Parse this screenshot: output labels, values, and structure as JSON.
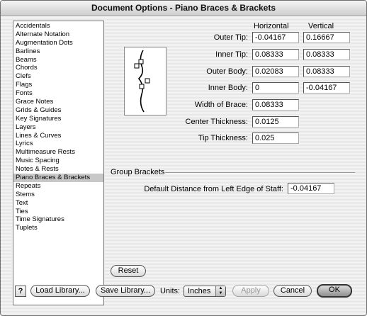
{
  "window": {
    "title": "Document Options - Piano Braces & Brackets"
  },
  "sidebar": {
    "items": [
      "Accidentals",
      "Alternate Notation",
      "Augmentation Dots",
      "Barlines",
      "Beams",
      "Chords",
      "Clefs",
      "Flags",
      "Fonts",
      "Grace Notes",
      "Grids & Guides",
      "Key Signatures",
      "Layers",
      "Lines & Curves",
      "Lyrics",
      "Multimeasure Rests",
      "Music Spacing",
      "Notes & Rests",
      "Piano Braces & Brackets",
      "Repeats",
      "Stems",
      "Text",
      "Ties",
      "Time Signatures",
      "Tuplets"
    ],
    "selected": "Piano Braces & Brackets"
  },
  "columns": {
    "horizontal": "Horizontal",
    "vertical": "Vertical"
  },
  "rows": [
    {
      "label": "Outer Tip:",
      "horizontal": "-0.04167",
      "vertical": "0.16667"
    },
    {
      "label": "Inner Tip:",
      "horizontal": "0.08333",
      "vertical": "0.08333"
    },
    {
      "label": "Outer Body:",
      "horizontal": "0.02083",
      "vertical": "0.08333"
    },
    {
      "label": "Inner Body:",
      "horizontal": "0",
      "vertical": "-0.04167"
    },
    {
      "label": "Width of Brace:",
      "horizontal": "0.08333"
    },
    {
      "label": "Center Thickness:",
      "horizontal": "0.0125"
    },
    {
      "label": "Tip Thickness:",
      "horizontal": "0.025"
    }
  ],
  "group_brackets": {
    "title": "Group Brackets",
    "distance_label": "Default Distance from Left Edge of Staff:",
    "distance_value": "-0.04167"
  },
  "buttons": {
    "reset": "Reset",
    "help": "?",
    "load_library": "Load Library...",
    "save_library": "Save Library...",
    "units_label": "Units:",
    "units_value": "Inches",
    "apply": "Apply",
    "cancel": "Cancel",
    "ok": "OK"
  }
}
